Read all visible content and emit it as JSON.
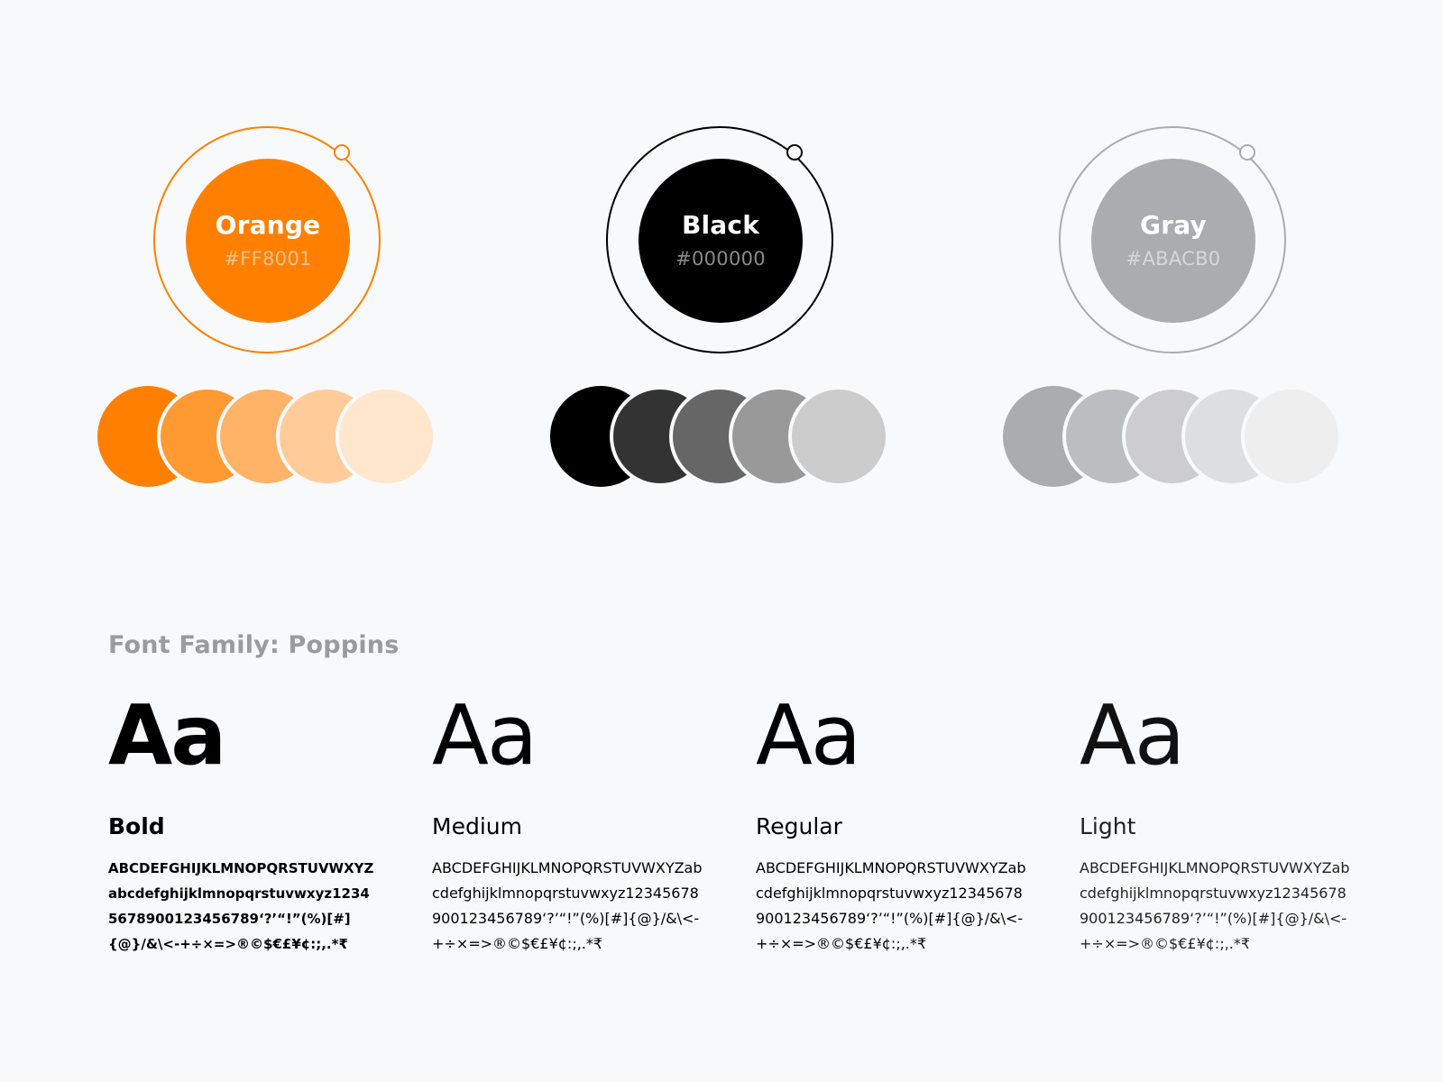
{
  "palette": [
    {
      "name": "Orange",
      "hex": "#FF8001",
      "color": "#FF8001",
      "hex_text_color": "#FFC08A",
      "tints": [
        "#FF8001",
        "#FF9A33",
        "#FFB366",
        "#FFCC99",
        "#FFE6CC"
      ]
    },
    {
      "name": "Black",
      "hex": "#000000",
      "color": "#000000",
      "hex_text_color": "#8A8A8A",
      "tints": [
        "#000000",
        "#333333",
        "#666666",
        "#999999",
        "#CCCCCC"
      ]
    },
    {
      "name": "Gray",
      "hex": "#ABACB0",
      "color": "#ABACB0",
      "hex_text_color": "#D6D7DA",
      "tints": [
        "#ABACB0",
        "#BCBDC0",
        "#CDCDD0",
        "#DDDEDF",
        "#EEEEEF"
      ]
    }
  ],
  "typography": {
    "title": "Font Family: Poppins",
    "sample_glyph": "Aa",
    "weights": [
      {
        "label": "Bold",
        "sample": "ABCDEFGHIJKLMNOPQRSTUVWXYZabcdefghijklmnopqrstuvwxyz12345678900123456789‘?’“!”(%)[#]{@}/&\\<-+÷×=>®©$€£¥¢:;,.*₹"
      },
      {
        "label": "Medium",
        "sample": "ABCDEFGHIJKLMNOPQRSTUVWXYZabcdefghijklmnopqrstuvwxyz12345678900123456789‘?’“!”(%)[#]{@}/&\\<-+÷×=>®©$€£¥¢:;,.*₹"
      },
      {
        "label": "Regular",
        "sample": "ABCDEFGHIJKLMNOPQRSTUVWXYZabcdefghijklmnopqrstuvwxyz12345678900123456789‘?’“!”(%)[#]{@}/&\\<-+÷×=>®©$€£¥¢:;,.*₹"
      },
      {
        "label": "Light",
        "sample": "ABCDEFGHIJKLMNOPQRSTUVWXYZabcdefghijklmnopqrstuvwxyz12345678900123456789‘?’“!”(%)[#]{@}/&\\<-+÷×=>®©$€£¥¢:;,.*₹"
      }
    ]
  }
}
